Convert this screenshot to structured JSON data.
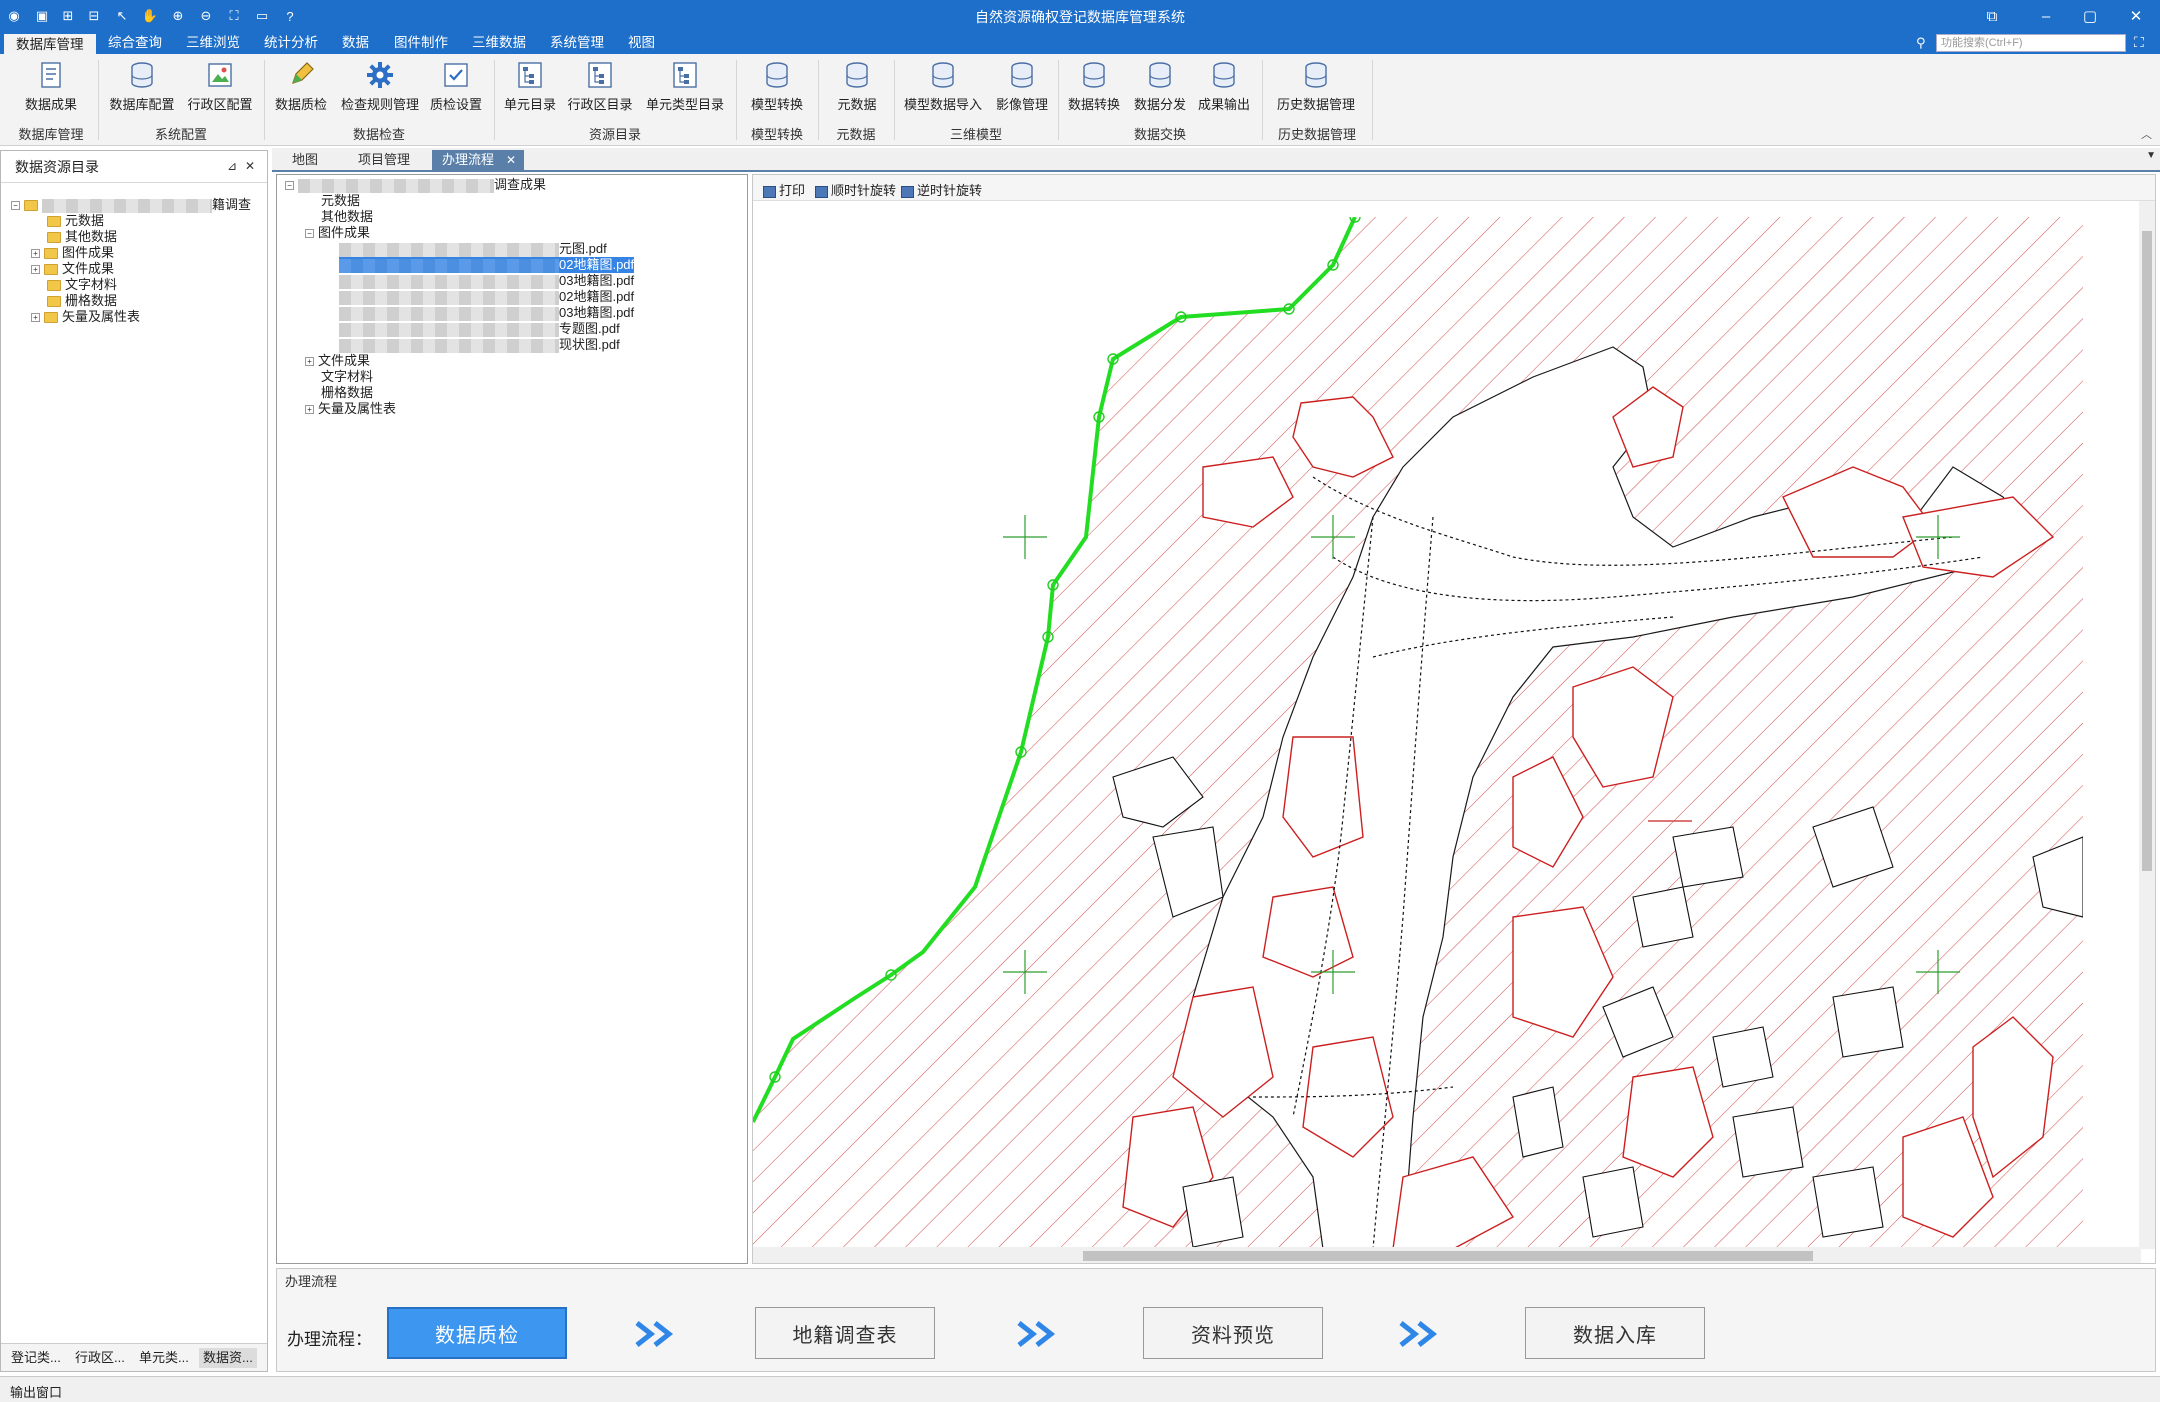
{
  "app": {
    "title": "自然资源确权登记数据库管理系统"
  },
  "menu": {
    "tabs": [
      "数据库管理",
      "综合查询",
      "三维浏览",
      "统计分析",
      "数据",
      "图件制作",
      "三维数据",
      "系统管理",
      "视图"
    ],
    "search_placeholder": "功能搜索(Ctrl+F)"
  },
  "ribbon": {
    "buttons": [
      "数据成果",
      "数据库配置",
      "行政区配置",
      "数据质检",
      "检查规则管理",
      "质检设置",
      "单元目录",
      "行政区目录",
      "单元类型目录",
      "模型转换",
      "元数据",
      "模型数据导入",
      "影像管理",
      "数据转换",
      "数据分发",
      "成果输出",
      "历史数据管理"
    ],
    "groups": [
      "数据库管理",
      "系统配置",
      "数据检查",
      "资源目录",
      "模型转换",
      "元数据",
      "三维模型",
      "数据交换",
      "历史数据管理"
    ]
  },
  "left_panel": {
    "title": "数据资源目录",
    "root_suffix": "籍调查",
    "items": [
      "元数据",
      "其他数据",
      "图件成果",
      "文件成果",
      "文字材料",
      "栅格数据",
      "矢量及属性表"
    ],
    "bottom_tabs": [
      "登记类...",
      "行政区...",
      "单元类...",
      "数据资..."
    ]
  },
  "doc_tabs": [
    "地图",
    "项目管理",
    "办理流程"
  ],
  "file_tree": {
    "root_suffix": "调查成果",
    "items": [
      "元数据",
      "其他数据",
      "图件成果"
    ],
    "pdf_files": [
      "元图.pdf",
      "02地籍图.pdf",
      "03地籍图.pdf",
      "02地籍图.pdf",
      "03地籍图.pdf",
      "专题图.pdf",
      "现状图.pdf"
    ],
    "items_after": [
      "文件成果",
      "文字材料",
      "栅格数据",
      "矢量及属性表"
    ]
  },
  "preview": {
    "tools": [
      "打印",
      "顺时针旋转",
      "逆时针旋转"
    ]
  },
  "process": {
    "title": "办理流程",
    "label": "办理流程：",
    "steps": [
      "数据质检",
      "地籍调查表",
      "资料预览",
      "数据入库"
    ]
  },
  "output": {
    "label": "输出窗口"
  },
  "colors": {
    "brand": "#1e6fc9",
    "active_step": "#3d97f0",
    "hatch": "#d04848",
    "boundary": "#22dd22"
  },
  "icons": [
    "save-icon",
    "new-icon",
    "open-icon",
    "pointer-icon",
    "hand-icon",
    "zoom-in-icon",
    "zoom-out-icon",
    "full-extent-icon",
    "folder-icon",
    "help-icon"
  ]
}
